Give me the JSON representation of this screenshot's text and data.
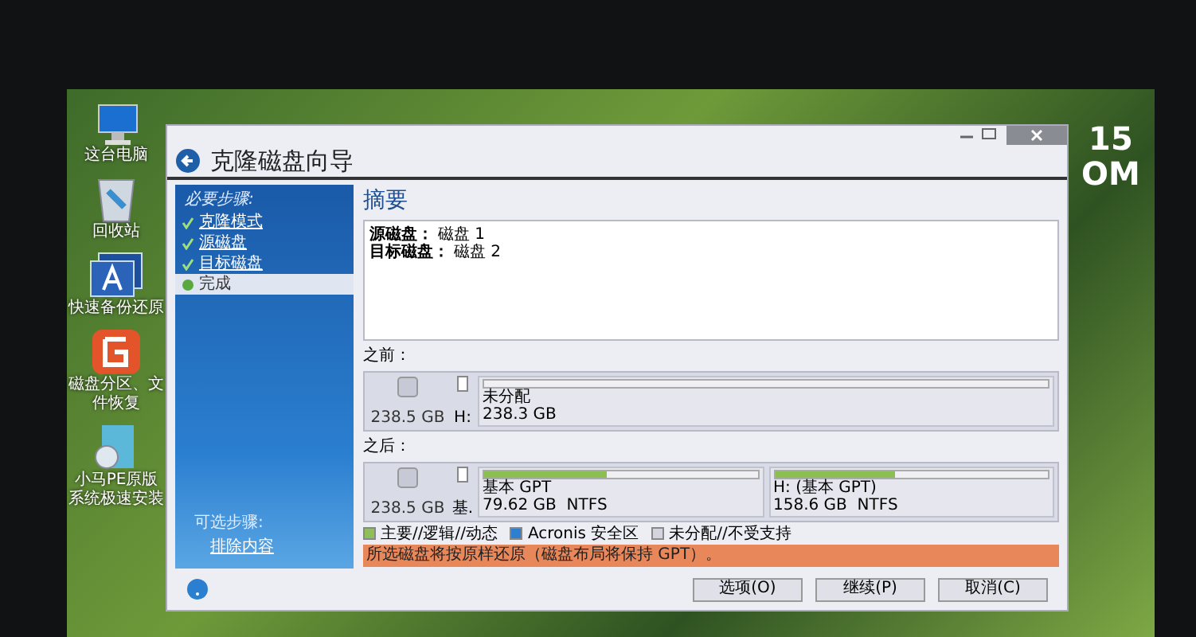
{
  "desktop_icons": [
    {
      "label": "这台电脑",
      "kind": "computer"
    },
    {
      "label": "回收站",
      "kind": "bin"
    },
    {
      "label": "快速备份还原",
      "kind": "backup"
    },
    {
      "label": "磁盘分区、文件恢复",
      "kind": "partition"
    },
    {
      "label": "小马PE原版系统极速安装",
      "kind": "installer"
    }
  ],
  "clock": {
    "line_1": "15",
    "line_2": "OM"
  },
  "window": {
    "title": "克隆磁盘向导"
  },
  "sidebar": {
    "required_heading": "必要步骤:",
    "steps": [
      {
        "label": "克隆模式",
        "done": true,
        "selected": false
      },
      {
        "label": "源磁盘",
        "done": true,
        "selected": false
      },
      {
        "label": "目标磁盘",
        "done": true,
        "selected": false
      },
      {
        "label": "完成",
        "done": false,
        "selected": true
      }
    ],
    "optional_heading": "可选步骤:",
    "optional_steps": [
      {
        "label": "排除内容"
      }
    ]
  },
  "summary": {
    "heading": "摘要",
    "lines": [
      {
        "label": "源磁盘：",
        "value": "磁盘 1"
      },
      {
        "label": "目标磁盘：",
        "value": "磁盘 2"
      }
    ]
  },
  "before": {
    "label": "之前：",
    "disk_size": "238.5 GB",
    "small_label": "H:",
    "partitions": [
      {
        "name": "未分配",
        "size": "238.3 GB"
      }
    ]
  },
  "after": {
    "label": "之后：",
    "disk_size": "238.5 GB",
    "small_label": "基.",
    "partitions": [
      {
        "name": "基本 GPT",
        "size": "79.62 GB  NTFS",
        "level": 0.45
      },
      {
        "name": "H: (基本 GPT)",
        "size": "158.6 GB  NTFS",
        "level": 0.44
      }
    ]
  },
  "legend": [
    {
      "label": "主要//逻辑//动态",
      "color": "#8fbf5a"
    },
    {
      "label": "Acronis 安全区",
      "color": "#2f7fd0"
    },
    {
      "label": "未分配//不受支持",
      "color": "#d4d4de"
    }
  ],
  "warning": "所选磁盘将按原样还原（磁盘布局将保持 GPT）。",
  "buttons": [
    {
      "label": "选项(O)"
    },
    {
      "label": "继续(P)"
    },
    {
      "label": "取消(C)"
    }
  ]
}
